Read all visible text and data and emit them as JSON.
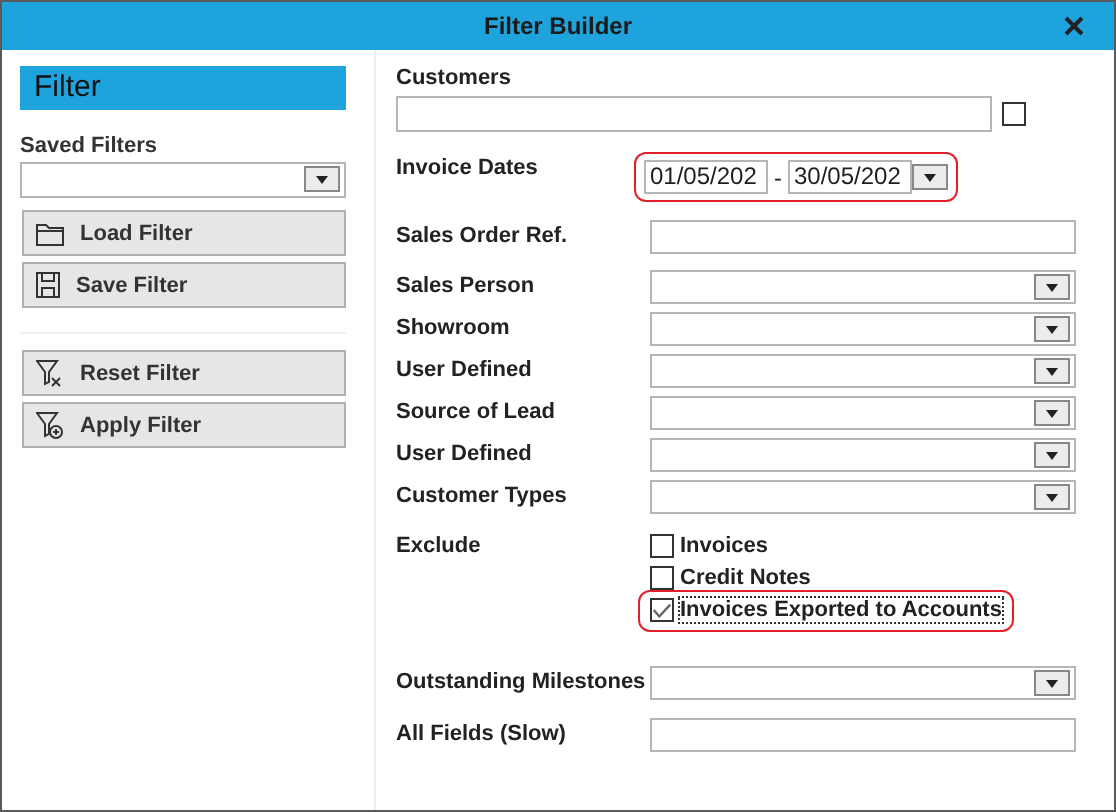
{
  "window": {
    "title": "Filter Builder"
  },
  "sidebar": {
    "heading": "Filter",
    "saved_filters": {
      "label": "Saved Filters"
    },
    "file_buttons": [
      {
        "label": "Load Filter",
        "kind": "folder"
      },
      {
        "label": "Save Filter",
        "kind": "save"
      }
    ],
    "filter_buttons": [
      {
        "label": "Reset Filter",
        "kind": "reset"
      },
      {
        "label": "Apply Filter",
        "kind": "apply"
      }
    ]
  },
  "fields": [
    {
      "kind": "customers",
      "label": "Customers",
      "checked": false
    },
    {
      "kind": "daterange",
      "label": "Invoice Dates",
      "from": "01/05/202",
      "separator": "-",
      "to": "30/05/202",
      "highlighted": true
    },
    {
      "kind": "text",
      "label": "Sales Order Ref."
    },
    {
      "kind": "select",
      "label": "Sales Person"
    },
    {
      "kind": "select",
      "label": "Showroom"
    },
    {
      "kind": "select",
      "label": "User Defined"
    },
    {
      "kind": "select",
      "label": "Source of Lead"
    },
    {
      "kind": "select",
      "label": "User Defined"
    },
    {
      "kind": "select",
      "label": "Customer Types"
    },
    {
      "kind": "checks",
      "label": "Exclude",
      "options": [
        {
          "label": "Invoices",
          "checked": false,
          "highlighted": false
        },
        {
          "label": "Credit Notes",
          "checked": false,
          "highlighted": false
        },
        {
          "label": "Invoices Exported to Accounts",
          "checked": true,
          "highlighted": true
        }
      ]
    },
    {
      "kind": "select",
      "label": "Outstanding Milestones"
    },
    {
      "kind": "text",
      "label": "All Fields (Slow)"
    }
  ]
}
